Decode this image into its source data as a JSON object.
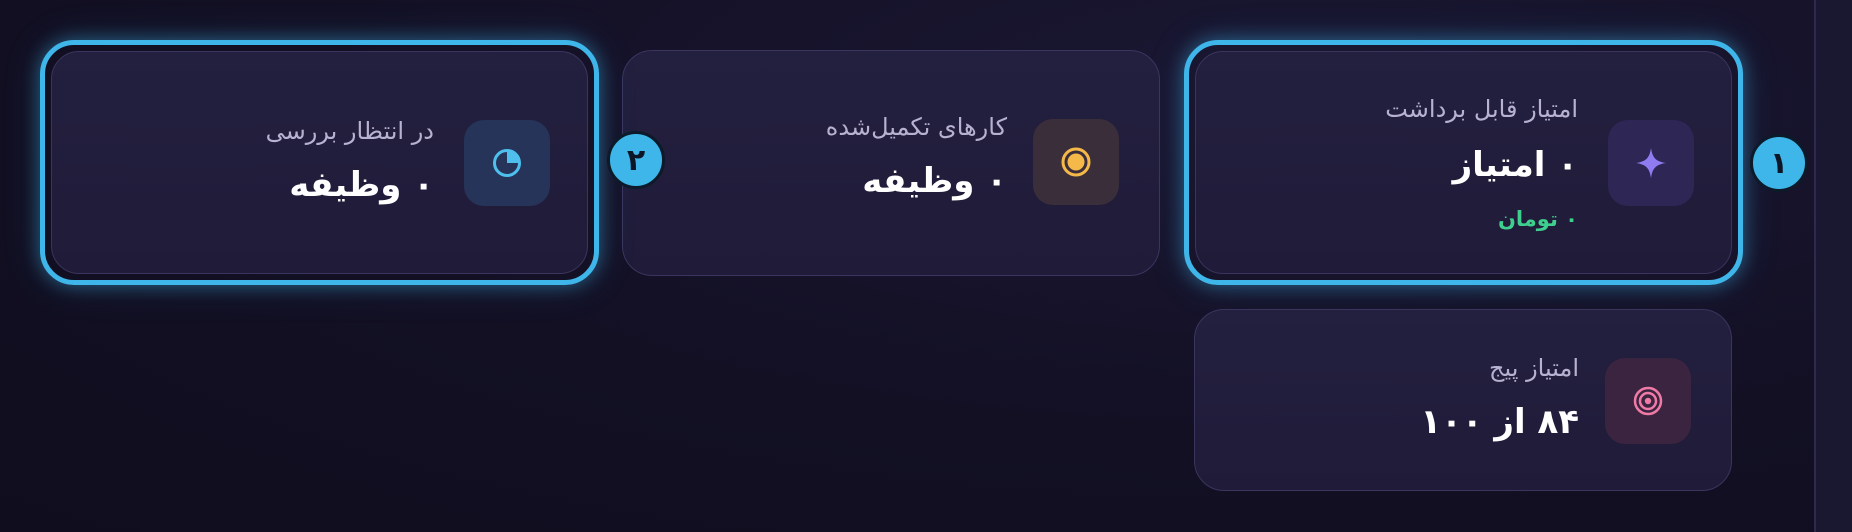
{
  "cards": {
    "withdrawable": {
      "label": "امتیاز قابل برداشت",
      "value": "۰ امتیاز",
      "sub": "۰ تومان",
      "icon": "sparkle-icon",
      "icon_color": "#8e7cf0"
    },
    "completed": {
      "label": "کارهای تکمیل‌شده",
      "value": "۰ وظیفه",
      "icon": "coin-icon",
      "icon_color": "#f5b94a"
    },
    "pending": {
      "label": "در انتظار بررسی",
      "value": "۰ وظیفه",
      "icon": "pie-chart-icon",
      "icon_color": "#4fc0ee"
    },
    "page_score": {
      "label": "امتیاز پیج",
      "value": "۸۴ از ۱۰۰",
      "icon": "target-icon",
      "icon_color": "#f07aa6"
    }
  },
  "badges": {
    "first": "۱",
    "second": "۲"
  },
  "colors": {
    "highlight": "#3fb6ea",
    "accent_green": "#3ecf8e",
    "background": "#131024"
  }
}
